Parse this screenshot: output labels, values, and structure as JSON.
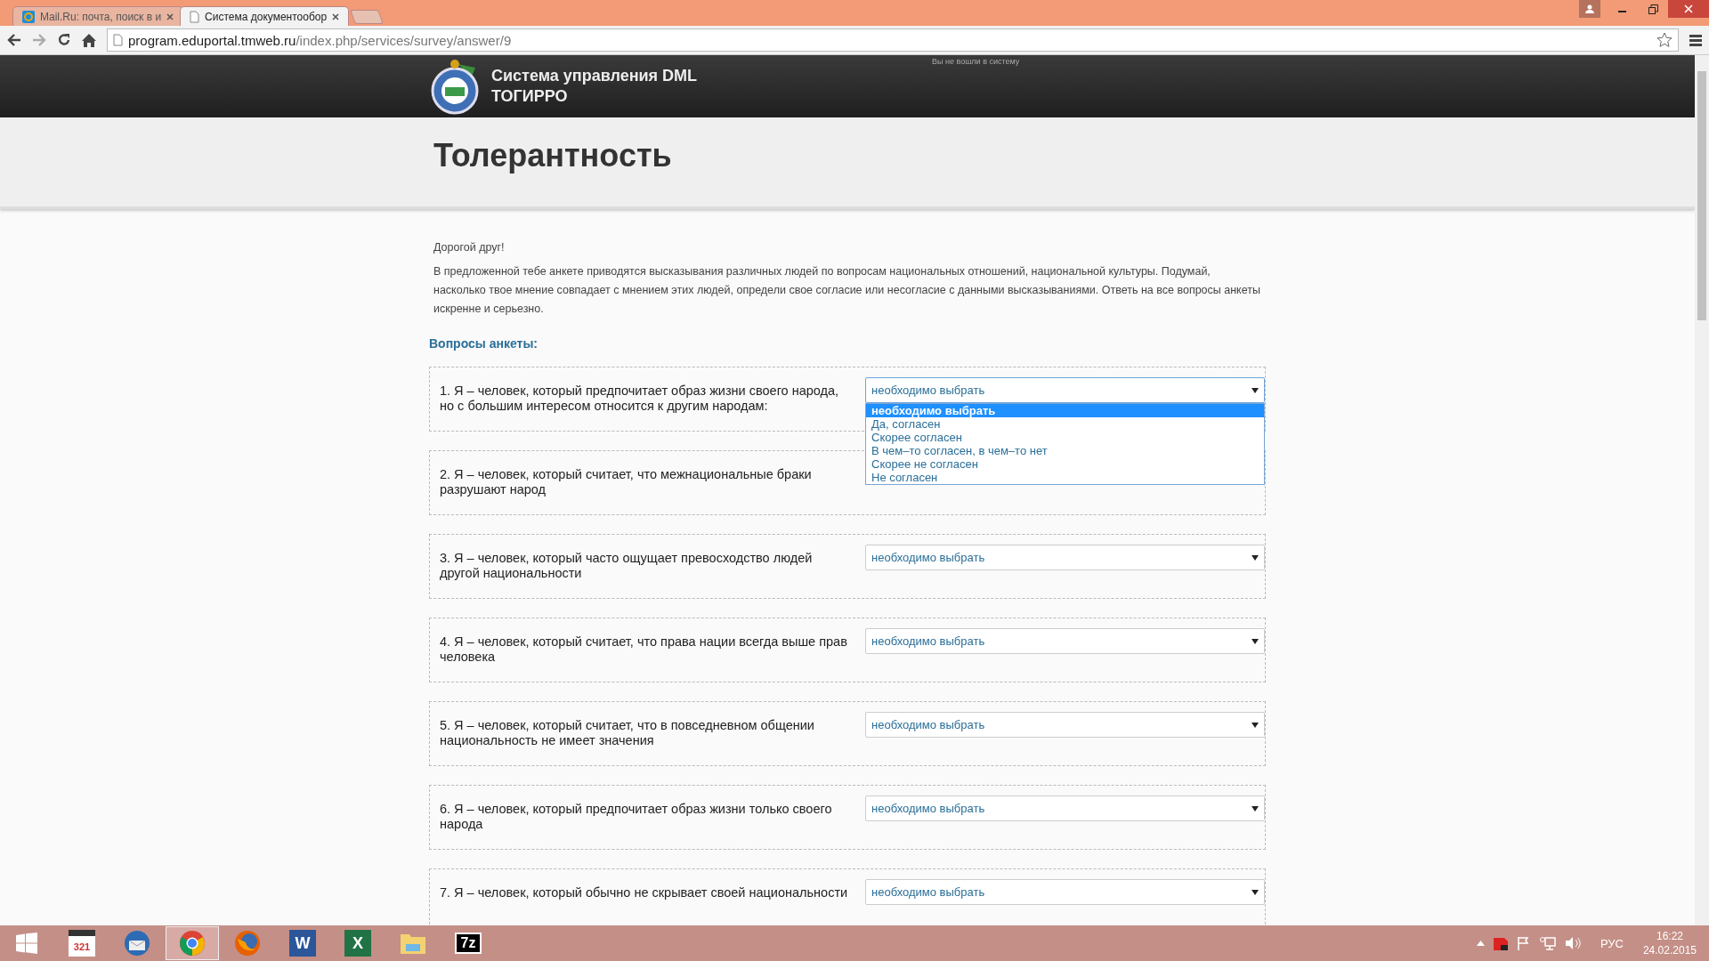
{
  "browser": {
    "tabs": [
      {
        "title": "Mail.Ru: почта, поиск в и",
        "kind": "mail",
        "selected": false
      },
      {
        "title": "Система документообор",
        "kind": "page",
        "selected": true
      }
    ],
    "address": {
      "host": "program.eduportal.tmweb.ru",
      "path": "/index.php/services/survey/answer/9"
    }
  },
  "header": {
    "logo_lines": [
      "Система управления DML",
      "ТОГИРРО"
    ],
    "login_status": "Вы не вошли в систему"
  },
  "page": {
    "title": "Толерантность",
    "greeting": "Дорогой друг!",
    "intro": "В предложенной тебе анкете приводятся высказывания различных людей по вопросам национальных отношений, национальной культуры. Подумай, насколько твое мнение совпадает с мнением этих людей, определи свое согласие или несогласие с данными высказываниями. Ответь на все вопросы анкеты искренне и серьезно.",
    "questions_heading": "Вопросы анкеты:",
    "questions": [
      {
        "text": "1. Я – человек, который предпочитает образ жизни своего народа, но с большим интересом относится к другим народам:",
        "answer": "необходимо выбрать",
        "options": [
          {
            "label": "необходимо выбрать",
            "selected": true
          },
          {
            "label": "Да, согласен",
            "selected": false
          },
          {
            "label": "Скорее согласен",
            "selected": false
          },
          {
            "label": "В чем–то согласен, в чем–то нет",
            "selected": false
          },
          {
            "label": "Скорее не согласен",
            "selected": false
          },
          {
            "label": "Не согласен",
            "selected": false
          }
        ]
      },
      {
        "text": "2. Я – человек, который считает, что межнациональные браки разрушают народ"
      },
      {
        "text": "3. Я – человек, который часто ощущает превосходство людей другой национальности",
        "answer": "необходимо выбрать"
      },
      {
        "text": "4. Я – человек, который считает, что права нации всегда выше прав человека",
        "answer": "необходимо выбрать"
      },
      {
        "text": "5. Я – человек, который считает, что в повседневном общении национальность не имеет значения",
        "answer": "необходимо выбрать"
      },
      {
        "text": "6. Я – человек, который предпочитает образ жизни только своего народа",
        "answer": "необходимо выбрать"
      },
      {
        "text": "7. Я – человек, который обычно не скрывает своей национальности",
        "answer": "необходимо выбрать"
      }
    ]
  },
  "taskbar": {
    "apps": [
      {
        "kind": "start",
        "active": false
      },
      {
        "kind": "player",
        "glyph": "321",
        "active": false
      },
      {
        "kind": "mail",
        "active": false
      },
      {
        "kind": "chrome",
        "active": true
      },
      {
        "kind": "firefox",
        "active": false
      },
      {
        "kind": "word",
        "glyph": "W",
        "active": false
      },
      {
        "kind": "excel",
        "glyph": "X",
        "active": false
      },
      {
        "kind": "folder",
        "active": false
      },
      {
        "kind": "archiver",
        "glyph": "7z",
        "active": false
      }
    ],
    "language": "РУС",
    "time": "16:22",
    "date": "24.02.2015"
  }
}
